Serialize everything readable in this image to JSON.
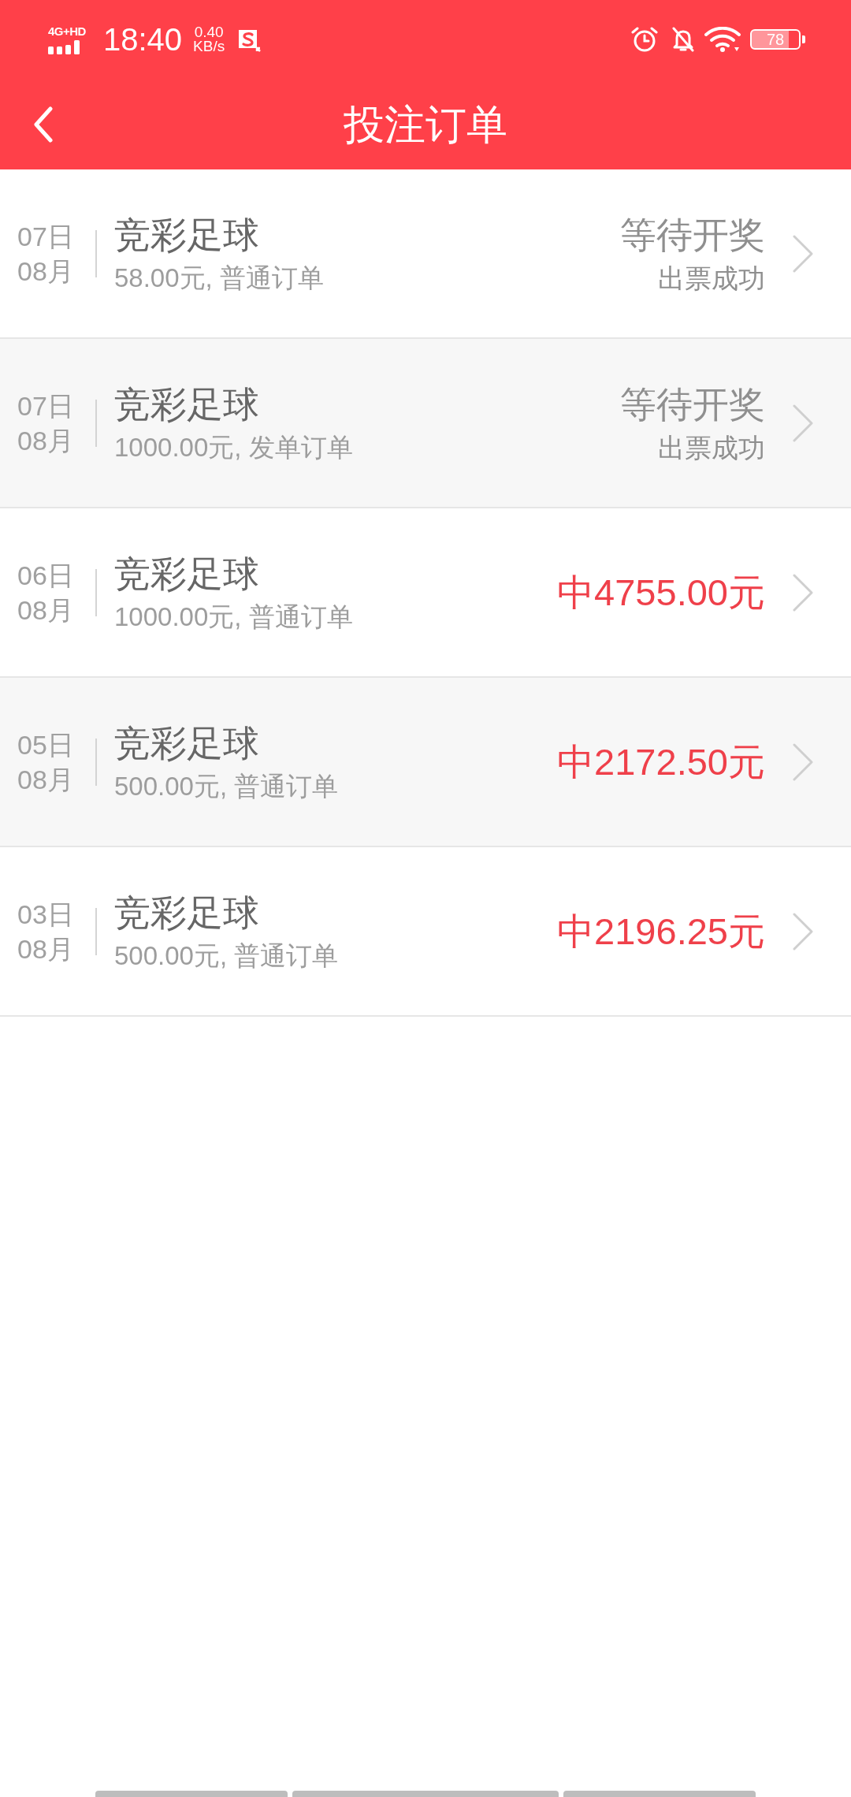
{
  "status_bar": {
    "network": "4G+HD",
    "time": "18:40",
    "speed_value": "0.40",
    "speed_unit": "KB/s",
    "battery": "78"
  },
  "header": {
    "title": "投注订单"
  },
  "orders": [
    {
      "day": "07日",
      "month": "08月",
      "title": "竞彩足球",
      "detail": "58.00元, 普通订单",
      "kind": "pending",
      "status": "等待开奖",
      "ticket_status": "出票成功"
    },
    {
      "day": "07日",
      "month": "08月",
      "title": "竞彩足球",
      "detail": "1000.00元, 发单订单",
      "kind": "pending",
      "status": "等待开奖",
      "ticket_status": "出票成功"
    },
    {
      "day": "06日",
      "month": "08月",
      "title": "竞彩足球",
      "detail": "1000.00元, 普通订单",
      "kind": "won",
      "prize": "中4755.00元"
    },
    {
      "day": "05日",
      "month": "08月",
      "title": "竞彩足球",
      "detail": "500.00元, 普通订单",
      "kind": "won",
      "prize": "中2172.50元"
    },
    {
      "day": "03日",
      "month": "08月",
      "title": "竞彩足球",
      "detail": "500.00元, 普通订单",
      "kind": "won",
      "prize": "中2196.25元"
    }
  ]
}
